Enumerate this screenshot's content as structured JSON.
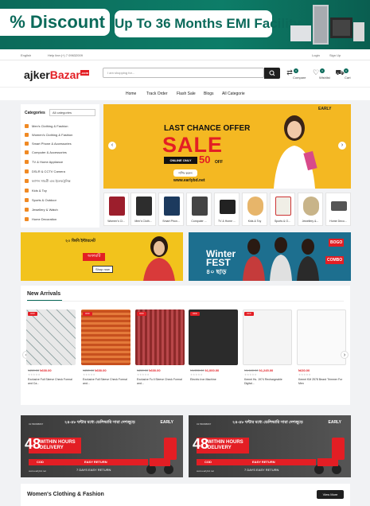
{
  "top_banner": {
    "discount": "% Discount",
    "emi": "Up To 36 Months EMI Facility"
  },
  "util_bar": {
    "lang": "English",
    "help": "Help line:(+) 7 09632009",
    "login": "Login",
    "signup": "Sign Up"
  },
  "header": {
    "logo_a": "ajker",
    "logo_b": "Bazar",
    "logo_tag": ".com",
    "search_placeholder": "I am shopping for...",
    "compare": "Compare",
    "wishlist": "Wishlist",
    "cart": "Cart",
    "compare_count": "0",
    "wishlist_count": "0",
    "cart_count": "0"
  },
  "nav": [
    "Home",
    "Track Order",
    "Flash Sale",
    "Blogs",
    "All Categorie"
  ],
  "categories": {
    "title": "Categories",
    "select": "All categories",
    "items": [
      "Men's Clothing & Fashion",
      "Women's Clothing & Fashion",
      "Smart Phone & Accessories",
      "Computer & Accessories",
      "TV & Home Appliance",
      "DSLR & CCTV Camera",
      "ফ্যাশন সামগ্রী এন্ড ইলেকট্রনিক্স",
      "Kids & Toy",
      "Sports & Outdoor",
      "Jewellery & Watch",
      "Home Decoration"
    ]
  },
  "hero": {
    "headline": "LAST CHANCE OFFER",
    "sale": "SALE",
    "online": "ONLINE ONLY",
    "percent": "50",
    "off": "OFF",
    "shop": "শপিং করুন",
    "url": "www.earlybd.net",
    "brand": "EARLY"
  },
  "cat_tiles": [
    "Women's Cl...",
    "Men's Cloth...",
    "Smart Phon...",
    "Computer ...",
    "TV & Home ...",
    "Kids & Toy",
    "Sports & O...",
    "Jewellery &...",
    "Home Deco..."
  ],
  "mid_banners": {
    "left_title": "২০ জিবি ইন্টারনেট",
    "left_tag": "অফারটি",
    "left_btn": "Shop now",
    "right_title": "Winter FEST",
    "right_sub": "৪০ ছাড়",
    "right_bogo": "BOGO",
    "right_combo": "COMBO"
  },
  "new_arrivals": {
    "title": "New Arrivals",
    "products": [
      {
        "old": "৳650.00",
        "price": "৳600.00",
        "name": "Exclusive Full Sleeve Check Formal and Ca...",
        "off": "OFF"
      },
      {
        "old": "৳650.00",
        "price": "৳600.00",
        "name": "Exclusive Full Sleeve Check Formal and...",
        "off": "OFF"
      },
      {
        "old": "৳650.00",
        "price": "৳600.00",
        "name": "Exclusive Fu ll Sleeve Check Formal and...",
        "off": "OFF"
      },
      {
        "old": "৳1,200.00",
        "price": "৳1,000.00",
        "name": "Electric Iron Machine",
        "off": "OFF"
      },
      {
        "old": "৳1,440.00",
        "price": "৳1,245.00",
        "name": "Kemei Hs. 1974 Rechargeable Digital...",
        "off": "OFF"
      },
      {
        "old": "",
        "price": "৳630.00",
        "name": "Kemei KM 2578 Beard Trimmer For Men",
        "off": ""
      }
    ]
  },
  "delivery_banner": {
    "bangla": "২৪-৪৮ ঘন্টার মধ্যে ডেলিভারি সারা দেশজুড়ে",
    "within": "WITHIN",
    "hours": "48",
    "hours_label": "HOURS DELIVERY",
    "cod": "COD",
    "easy": "EASY RETURN",
    "return": "7 DAYS EASY RETURN",
    "early": "EARLY",
    "url": "www.earlybd.net",
    "phone": "01780688807"
  },
  "bottom_section": {
    "title": "Women's Clothing & Fashion",
    "view_more": "View More"
  }
}
